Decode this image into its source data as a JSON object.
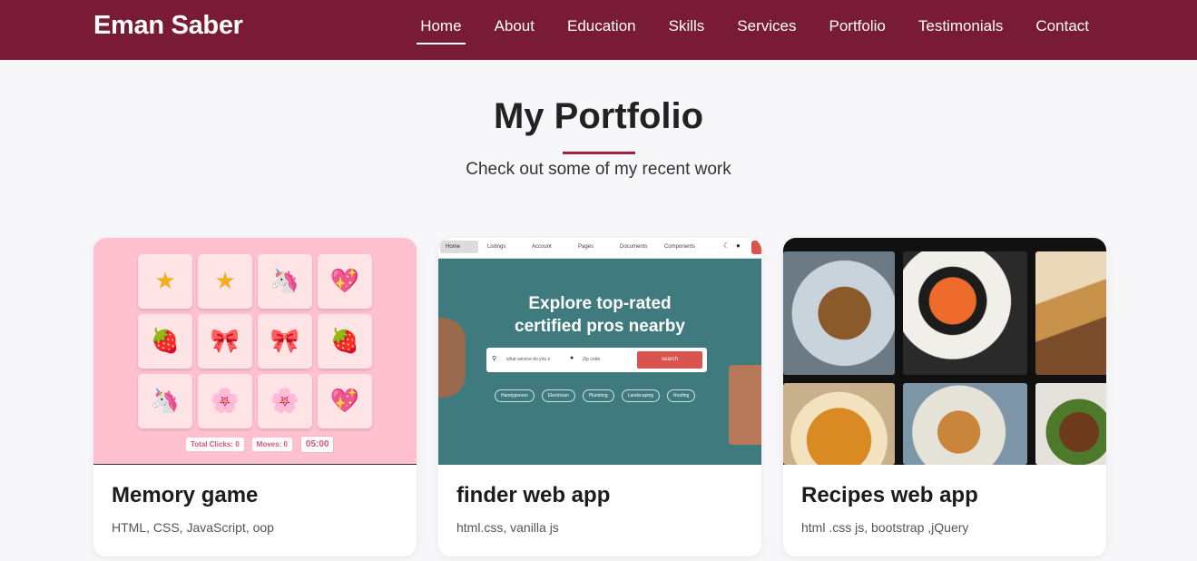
{
  "header": {
    "brand": "Eman Saber",
    "nav": [
      "Home",
      "About",
      "Education",
      "Skills",
      "Services",
      "Portfolio",
      "Testimonials",
      "Contact"
    ],
    "active": "Home"
  },
  "section": {
    "title": "My Portfolio",
    "subtitle": "Check out some of my recent work"
  },
  "projects": [
    {
      "title": "Memory game",
      "tech": "HTML, CSS, JavaScript, oop",
      "preview": {
        "tiles": [
          "★",
          "★",
          "🦄",
          "💖",
          "🍓",
          "🎀",
          "🎀",
          "🍓",
          "🦄",
          "🌸",
          "🌸",
          "💖"
        ],
        "total_clicks": "Total Clicks: 0",
        "moves": "Moves: 0",
        "timer": "05:00"
      }
    },
    {
      "title": "finder web app",
      "tech": "html.css, vanilla js",
      "preview": {
        "nav": [
          "Home",
          "Listings",
          "Account",
          "Pages",
          "Documents",
          "Components"
        ],
        "hero_line1": "Explore top-rated",
        "hero_line2": "certified pros nearby",
        "search_placeholder": "what service do you n",
        "zip_placeholder": "Zip code",
        "search_button": "search",
        "tags": [
          "Handyperson",
          "Electrician",
          "Plumbing",
          "Landscaping",
          "Roofing"
        ]
      }
    },
    {
      "title": "Recipes web app",
      "tech": "html .css js, bootstrap ,jQuery"
    }
  ],
  "colors": {
    "primary": "#791a37",
    "accent": "#a3213f",
    "background": "#f7f7f9"
  }
}
